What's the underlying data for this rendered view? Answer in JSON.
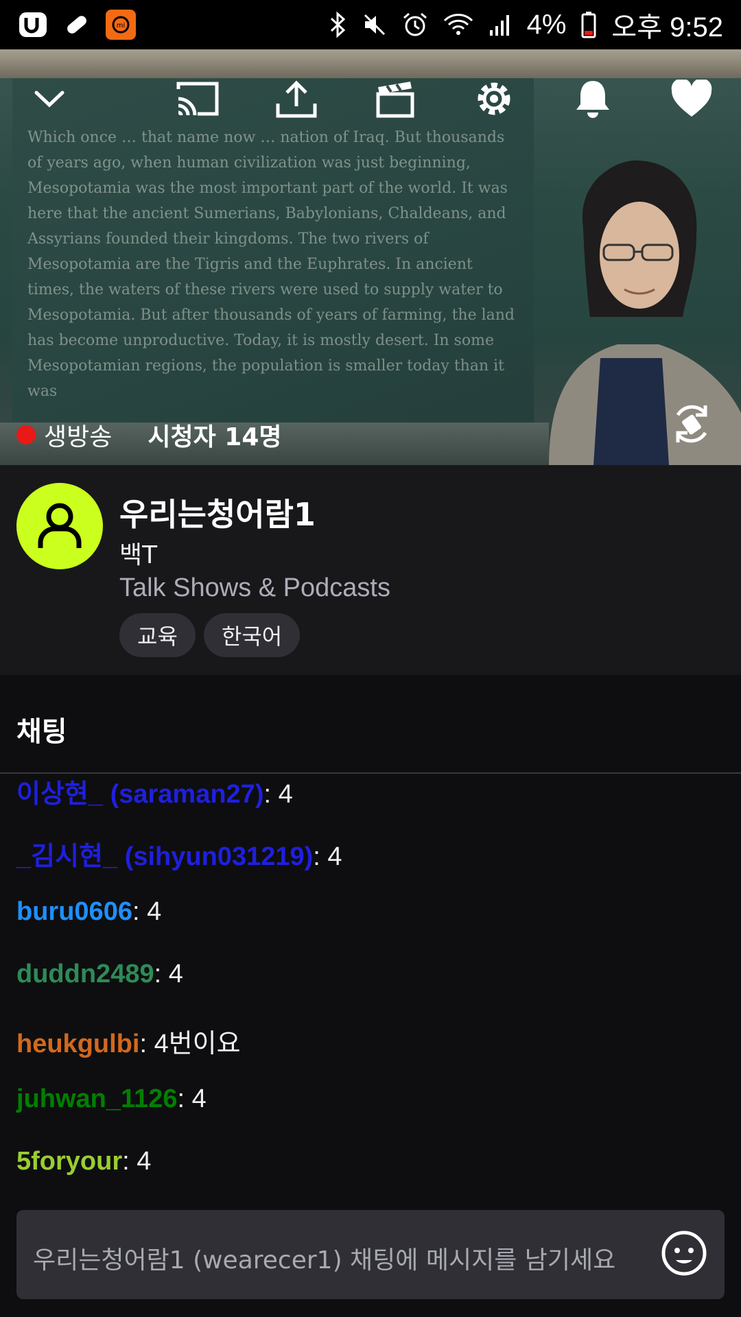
{
  "status_bar": {
    "battery": "4%",
    "time": "오후 9:52",
    "icons": [
      "app-u-icon",
      "bandage-icon",
      "mi-icon",
      "bluetooth-icon",
      "mute-icon",
      "alarm-icon",
      "wifi-icon",
      "signal-icon",
      "battery-icon"
    ]
  },
  "player": {
    "live_label": "생방송",
    "viewers_label": "시청자 14명",
    "toolbar_icons": [
      "chevron-down-icon",
      "cast-icon",
      "share-icon",
      "clip-icon",
      "gear-icon",
      "bell-icon",
      "heart-icon"
    ],
    "board_text": "Which once … that name now … nation of Iraq. But thousands of years ago, when human civilization was just beginning, Mesopotamia was the most important part of the world. It was here that the ancient Sumerians, Babylonians, Chaldeans, and Assyrians founded their kingdoms. The two rivers of Mesopotamia are the Tigris and the Euphrates. In ancient times, the waters of these rivers were used to supply water to Mesopotamia. But after thousands of years of farming, the land has become unproductive. Today, it is mostly desert. In some Mesopotamian regions, the population is smaller today than it was"
  },
  "channel": {
    "name": "우리는청어람1",
    "subtitle": "백T",
    "category": "Talk Shows & Podcasts",
    "tags": [
      "교육",
      "한국어"
    ]
  },
  "chat": {
    "title": "채팅",
    "messages": [
      {
        "user": "이상현_ (saraman27)",
        "text": "4",
        "color": "#1f1fe0"
      },
      {
        "user": "_김시현_ (sihyun031219)",
        "text": "4",
        "color": "#1f1fe0"
      },
      {
        "user": "buru0606",
        "text": "4",
        "color": "#1e90ff"
      },
      {
        "user": "duddn2489",
        "text": "4",
        "color": "#2e8b57"
      },
      {
        "user": "heukgulbi",
        "text": "4번이요",
        "color": "#d2691e"
      },
      {
        "user": "juhwan_1126",
        "text": "4",
        "color": "#008000"
      },
      {
        "user": "5foryour",
        "text": "4",
        "color": "#9acd32"
      }
    ],
    "input_placeholder": "우리는청어람1 (wearecer1) 채팅에 메시지를 남기세요"
  },
  "colors": {
    "accent_avatar": "#cbff1d",
    "live_dot": "#e91916",
    "background": "#0e0e10",
    "panel": "#18181b"
  }
}
